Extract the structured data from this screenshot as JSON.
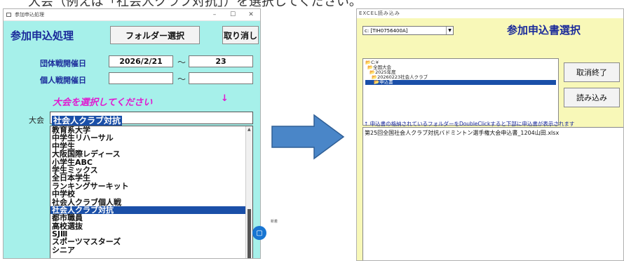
{
  "instruction_top": "大会（例えば「社会人クラブ対抗」）を選択してください。",
  "win1": {
    "title": "参加申込処理",
    "header": "参加申込処理",
    "folder_button": "フォルダー選択",
    "cancel_button": "取り消し",
    "team_date_label": "団体戦開催日",
    "team_date_value": "2026/2/21",
    "team_date_end": "23",
    "indiv_date_label": "個人戦開催日",
    "indiv_date_value": "",
    "indiv_date_end": "",
    "tilde": "〜",
    "prompt": "大会を選択してください",
    "prompt_arrow": "↓",
    "taikai_label": "大会",
    "selected_taikai": "社会人クラブ対抗",
    "list_items": [
      "教育系大学",
      "中学生リハーサル",
      "中学生",
      "大阪国際レディース",
      "小学生ABC",
      "学生ミックス",
      "全日本学生",
      "ランキングサーキット",
      "中学校",
      "社会人クラブ個人戦",
      "社会人クラブ対抗",
      "都市職員",
      "高校選抜",
      "SJⅢ",
      "スポーツマスターズ",
      "シニア"
    ],
    "selected_index": 10,
    "notif_text": "新着"
  },
  "win2": {
    "title": "EXCEL読み込み",
    "drive": "c: [TIH0756400A]",
    "header": "参加申込書選択",
    "tree": [
      "C:¥",
      "全国大会",
      "2025年度",
      "20260223社会人クラブ",
      "申込書"
    ],
    "tree_selected_index": 4,
    "close_button": "取消終了",
    "load_button": "読み込み",
    "notice": "↑ 申込書の格納されているフォルダーをDoubleClickすると下部に申込書が表示されます",
    "files": [
      "第25回全国社会人クラブ対抗バドミントン選手権大会申込書_1204山田.xlsx"
    ]
  },
  "colors": {
    "win1_bg": "#a6f0ea",
    "win2_bg": "#f8f8b8",
    "selection": "#1a4fa8",
    "heading": "#1a2a9a",
    "prompt": "#e01ad0",
    "arrow": "#4a86c8"
  }
}
